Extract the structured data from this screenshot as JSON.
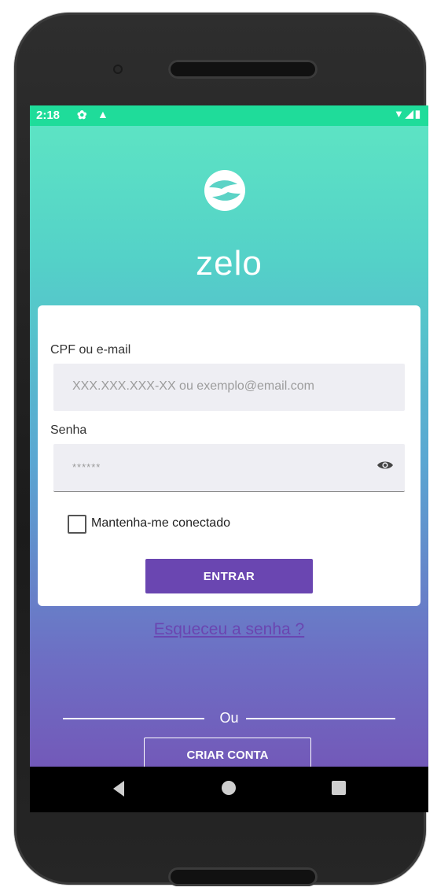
{
  "status_bar": {
    "time": "2:18",
    "settings_icon": "gear-icon",
    "alert_icon": "warning-icon",
    "right_icons": "▼◢▮"
  },
  "brand": {
    "logo_icon": "hands-icon",
    "name": "zelo"
  },
  "login_form": {
    "cpf_label": "CPF ou e-mail",
    "cpf_placeholder": "XXX.XXX.XXX-XX ou exemplo@email.com",
    "password_label": "Senha",
    "password_placeholder": "******",
    "password_toggle_icon": "eye-icon",
    "remember_label": "Mantenha-me conectado",
    "remember_checked": false,
    "submit_label": "ENTRAR",
    "forgot_label": "Esqueceu a senha ?"
  },
  "divider_label": "Ou",
  "create_account_label": "CRIAR CONTA",
  "nav_bar": {
    "back_icon": "back-icon",
    "home_icon": "home-icon",
    "recents_icon": "recents-icon"
  },
  "colors": {
    "accent": "#6a46b1",
    "status_bar": "#1fdc9a",
    "gradient_top": "#5ee6c3",
    "gradient_bottom": "#7550b4"
  }
}
